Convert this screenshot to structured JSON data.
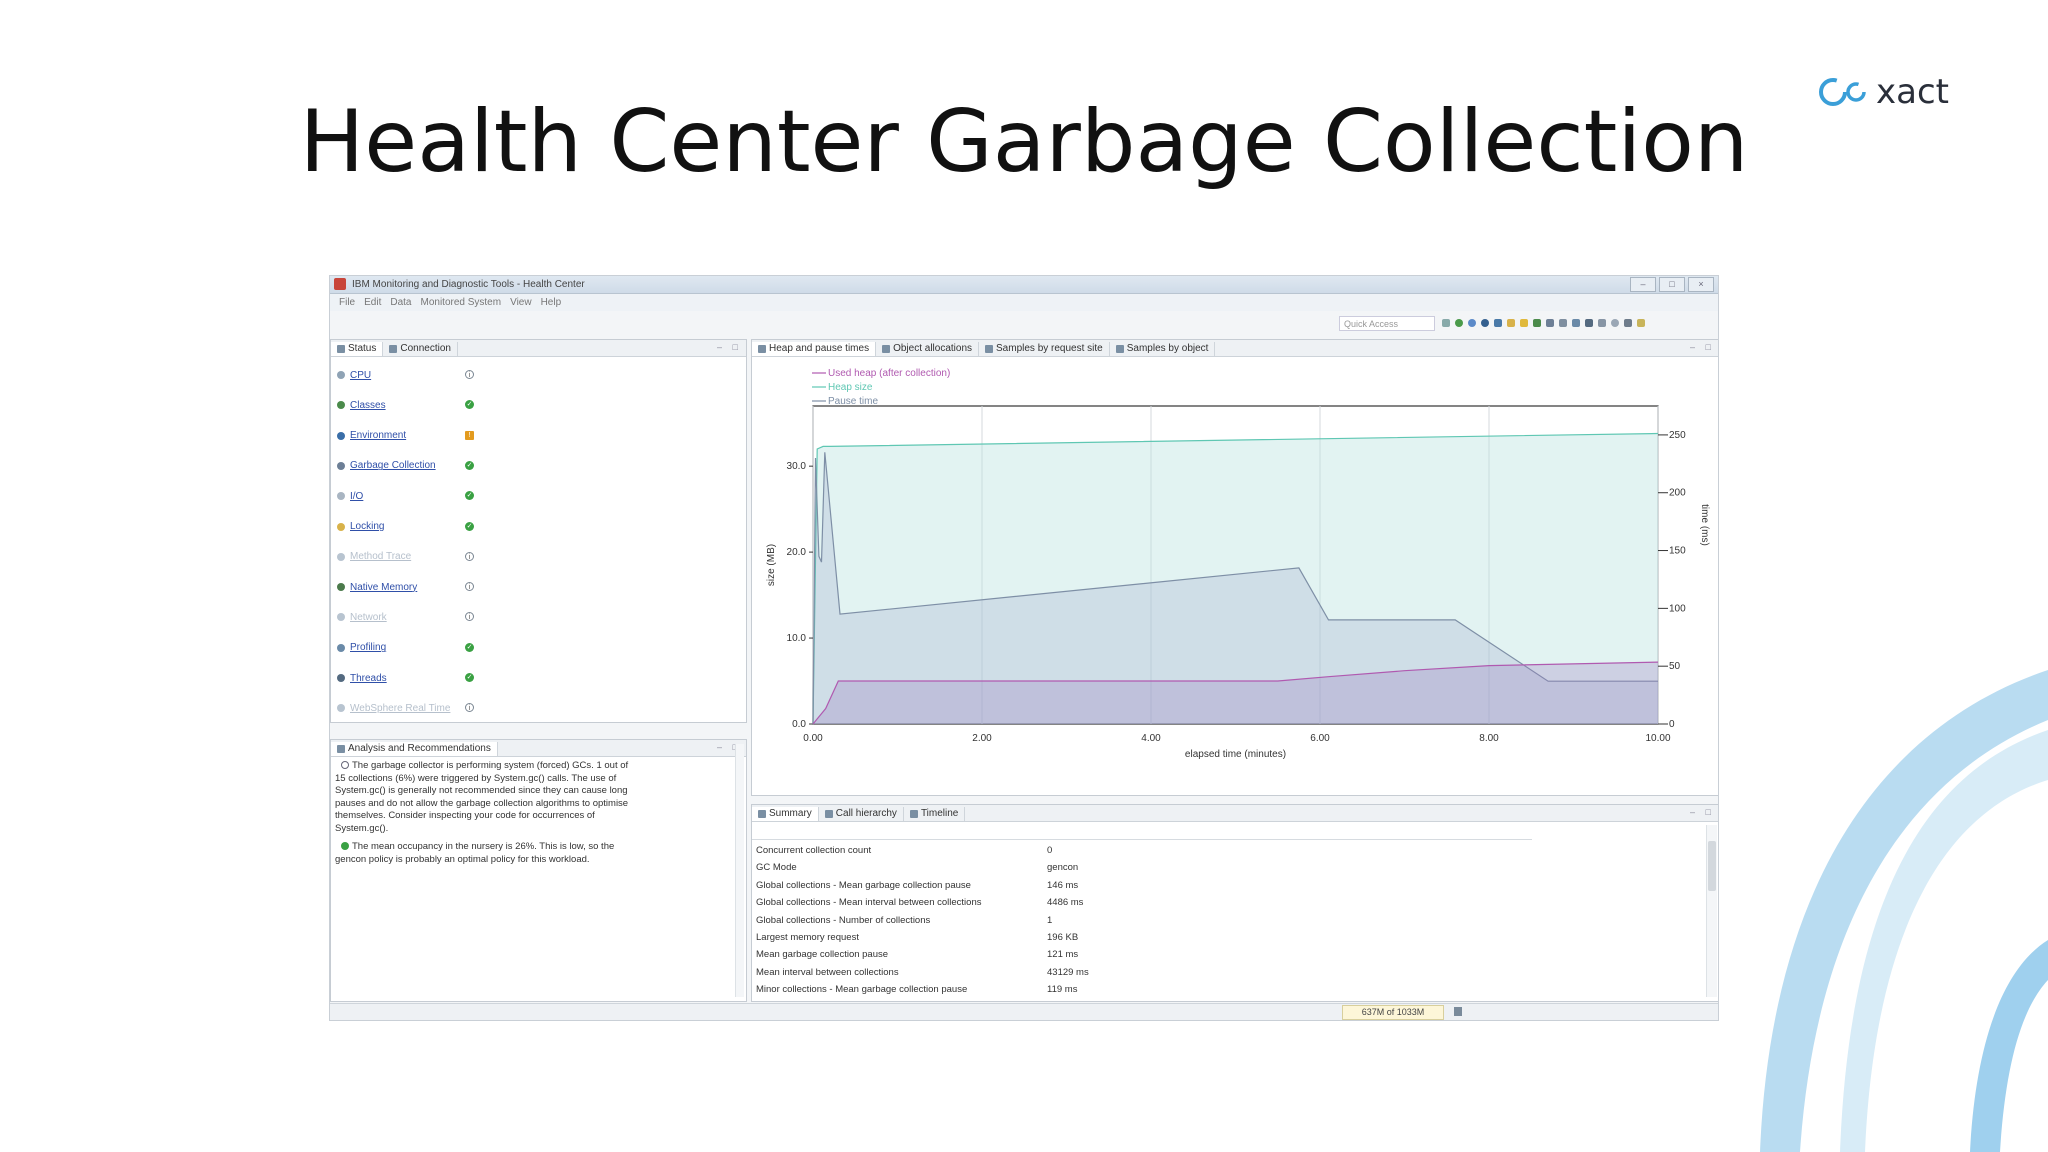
{
  "slide": {
    "title": "Health Center Garbage Collection",
    "logo_text": "xact"
  },
  "window": {
    "title": "IBM Monitoring and Diagnostic Tools - Health Center",
    "menu": [
      "File",
      "Edit",
      "Data",
      "Monitored System",
      "View",
      "Help"
    ],
    "quick_access_placeholder": "Quick Access"
  },
  "status_panel": {
    "tabs": [
      "Status",
      "Connection"
    ],
    "items": [
      {
        "label": "CPU",
        "indicator": "info",
        "enabled": true,
        "icon": "cpu-icon"
      },
      {
        "label": "Classes",
        "indicator": "ok",
        "enabled": true,
        "icon": "classes-icon"
      },
      {
        "label": "Environment",
        "indicator": "warn",
        "enabled": true,
        "icon": "environment-icon"
      },
      {
        "label": "Garbage Collection",
        "indicator": "ok",
        "enabled": true,
        "icon": "garbage-collection-icon"
      },
      {
        "label": "I/O",
        "indicator": "ok",
        "enabled": true,
        "icon": "io-icon"
      },
      {
        "label": "Locking",
        "indicator": "ok",
        "enabled": true,
        "icon": "lock-icon"
      },
      {
        "label": "Method Trace",
        "indicator": "info",
        "enabled": false,
        "icon": "method-trace-icon"
      },
      {
        "label": "Native Memory",
        "indicator": "info",
        "enabled": true,
        "icon": "native-memory-icon"
      },
      {
        "label": "Network",
        "indicator": "info",
        "enabled": false,
        "icon": "network-icon"
      },
      {
        "label": "Profiling",
        "indicator": "ok",
        "enabled": true,
        "icon": "profiling-icon"
      },
      {
        "label": "Threads",
        "indicator": "ok",
        "enabled": true,
        "icon": "threads-icon"
      },
      {
        "label": "WebSphere Real Time",
        "indicator": "info",
        "enabled": false,
        "icon": "websphere-icon"
      }
    ]
  },
  "analysis_panel": {
    "tab": "Analysis and Recommendations",
    "messages": [
      {
        "type": "info",
        "text": "The garbage collector is performing system (forced) GCs. 1 out of 15 collections (6%) were triggered by System.gc() calls. The use of System.gc() is generally not recommended since they can cause long pauses and do not allow the garbage collection algorithms to optimise themselves. Consider inspecting your code for occurrences of System.gc()."
      },
      {
        "type": "ok",
        "text": "The mean occupancy in the nursery is 26%. This is low, so the gencon policy is probably an optimal policy for this workload."
      }
    ]
  },
  "chart_tabs": [
    "Heap and pause times",
    "Object allocations",
    "Samples by request site",
    "Samples by object"
  ],
  "chart_data": {
    "type": "area",
    "legend_position": "top-left",
    "legend": [
      "Used heap (after collection)",
      "Heap size",
      "Pause time"
    ],
    "xlabel": "elapsed time (minutes)",
    "ylabel": "size (MB)",
    "y2label": "time (ms)",
    "xlim": [
      0,
      10
    ],
    "ylim": [
      0,
      37
    ],
    "y2lim": [
      0,
      275
    ],
    "x_ticks": [
      "0.00",
      "2.00",
      "4.00",
      "6.00",
      "8.00",
      "10.00"
    ],
    "y_ticks": [
      "0.0",
      "10.0",
      "20.0",
      "30.0"
    ],
    "y2_ticks": [
      "0",
      "50",
      "100",
      "150",
      "200",
      "250"
    ],
    "grid": true,
    "series": [
      {
        "name": "Heap size",
        "color": "#5fc7b3",
        "axis": "left",
        "x": [
          0,
          0.05,
          0.12,
          0.2,
          10.0
        ],
        "y": [
          0,
          32.0,
          32.3,
          32.3,
          33.8
        ]
      },
      {
        "name": "Pause time",
        "color": "#7e8fa6",
        "axis": "right",
        "x": [
          0,
          0.03,
          0.07,
          0.1,
          0.14,
          0.32,
          5.75,
          6.1,
          7.6,
          8.7,
          10.0
        ],
        "y": [
          0,
          230,
          145,
          140,
          235,
          95,
          135,
          90,
          90,
          37,
          37
        ]
      },
      {
        "name": "Used heap (after collection)",
        "color": "#b05ab0",
        "axis": "left",
        "x": [
          0,
          0.15,
          0.3,
          5.5,
          6.1,
          7.0,
          8.0,
          10.0
        ],
        "y": [
          0,
          1.8,
          5.0,
          5.0,
          5.5,
          6.2,
          6.8,
          7.2
        ]
      }
    ]
  },
  "summary_panel": {
    "tabs": [
      "Summary",
      "Call hierarchy",
      "Timeline"
    ],
    "rows": [
      {
        "key": "Concurrent collection count",
        "value": "0"
      },
      {
        "key": "GC Mode",
        "value": "gencon"
      },
      {
        "key": "Global collections - Mean garbage collection pause",
        "value": "146 ms"
      },
      {
        "key": "Global collections - Mean interval between collections",
        "value": "4486 ms"
      },
      {
        "key": "Global collections - Number of collections",
        "value": "1"
      },
      {
        "key": "Largest memory request",
        "value": "196 KB"
      },
      {
        "key": "Mean garbage collection pause",
        "value": "121 ms"
      },
      {
        "key": "Mean interval between collections",
        "value": "43129 ms"
      },
      {
        "key": "Minor collections - Mean garbage collection pause",
        "value": "119 ms"
      }
    ]
  },
  "statusbar": {
    "memory": "637M of 1033M"
  }
}
